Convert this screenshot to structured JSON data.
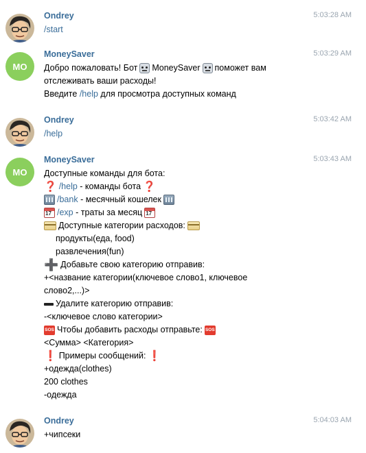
{
  "messages": [
    {
      "sender": "Ondrey",
      "time": "5:03:28 AM",
      "avatar": "photo",
      "lines": [
        {
          "cmd": "/start"
        }
      ]
    },
    {
      "sender": "MoneySaver",
      "time": "5:03:29 AM",
      "avatar": "MO",
      "lines": [
        {
          "pre": "Добро пожаловать! Бот",
          "mid": "MoneySaver",
          "post": "поможет вам"
        },
        {
          "text": "отслеживать ваши расходы!"
        },
        {
          "pre": "Введите",
          "cmd": "/help",
          "post": "для просмотра доступных команд"
        }
      ]
    },
    {
      "sender": "Ondrey",
      "time": "5:03:42 AM",
      "avatar": "photo",
      "lines": [
        {
          "cmd": "/help"
        }
      ]
    },
    {
      "sender": "MoneySaver",
      "time": "5:03:43 AM",
      "avatar": "MO",
      "lines": [
        {
          "text": "Доступные команды для бота:"
        },
        {
          "cmd": "/help",
          "post": "- команды бота"
        },
        {
          "cmd": "/bank",
          "post": "- месячный кошелек"
        },
        {
          "cmd": "/exp",
          "post": "- траты за месяц"
        },
        {
          "text": "Доступные категории расходов:"
        },
        {
          "text": "продукты(еда, food)"
        },
        {
          "text": "развлечения(fun)"
        },
        {
          "text": "Добавьте свою категорию отправив:"
        },
        {
          "text": "+<название категории(ключевое слово1, ключевое"
        },
        {
          "text": "слово2,...)>"
        },
        {
          "text": "Удалите категорию отправив:"
        },
        {
          "text": "-<ключевое слово категории>"
        },
        {
          "text": "Чтобы добавить расходы отправьте:"
        },
        {
          "text": "<Сумма> <Категория>"
        },
        {
          "text": "Примеры сообщений:"
        },
        {
          "text": "+одежда(clothes)"
        },
        {
          "text": "200 clothes"
        },
        {
          "text": "-одежда"
        }
      ]
    },
    {
      "sender": "Ondrey",
      "time": "5:04:03 AM",
      "avatar": "photo",
      "lines": [
        {
          "text": "+чипсеки"
        }
      ]
    }
  ],
  "emoji": {
    "question": "❓",
    "exclamation": "❗",
    "plus": "➕",
    "sos": "SOS",
    "bank": "bank-icon",
    "calendar": "calendar-icon",
    "card": "credit-card-icon",
    "robot": "robot-icon"
  },
  "colors": {
    "link": "#3a6d99",
    "sender": "#3a6d99",
    "time": "#9aa5b0",
    "bot_avatar": "#8bcf5d"
  }
}
